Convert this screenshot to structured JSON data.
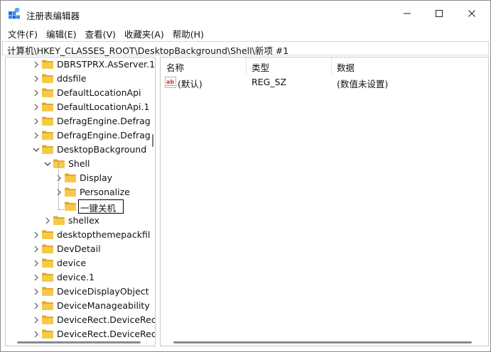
{
  "window": {
    "title": "注册表编辑器"
  },
  "menu": [
    "文件(F)",
    "编辑(E)",
    "查看(V)",
    "收藏夹(A)",
    "帮助(H)"
  ],
  "address": "计算机\\HKEY_CLASSES_ROOT\\DesktopBackground\\Shell\\新项 #1",
  "tree": [
    {
      "label": "DBRSTPRX.AsServer.1",
      "chevron": "right"
    },
    {
      "label": "ddsfile",
      "chevron": "right"
    },
    {
      "label": "DefaultLocationApi",
      "chevron": "right"
    },
    {
      "label": "DefaultLocationApi.1",
      "chevron": "right"
    },
    {
      "label": "DefragEngine.Defrag",
      "chevron": "right"
    },
    {
      "label": "DefragEngine.Defrag",
      "chevron": "right"
    },
    {
      "label": "DesktopBackground",
      "chevron": "down"
    },
    {
      "label": "Shell",
      "chevron": "down"
    },
    {
      "label": "Display",
      "chevron": "right"
    },
    {
      "label": "Personalize",
      "chevron": "right"
    },
    {
      "label": "一键关机",
      "chevron": "none",
      "editing": true
    },
    {
      "label": "shellex",
      "chevron": "right"
    },
    {
      "label": "desktopthemepackfil",
      "chevron": "right"
    },
    {
      "label": "DevDetail",
      "chevron": "right"
    },
    {
      "label": "device",
      "chevron": "right"
    },
    {
      "label": "device.1",
      "chevron": "right"
    },
    {
      "label": "DeviceDisplayObject",
      "chevron": "right"
    },
    {
      "label": "DeviceManageability",
      "chevron": "right"
    },
    {
      "label": "DeviceRect.DeviceRec",
      "chevron": "right"
    },
    {
      "label": "DeviceRect.DeviceRec",
      "chevron": "right"
    }
  ],
  "list": {
    "columns": [
      "名称",
      "类型",
      "数据"
    ],
    "rows": [
      {
        "name": "(默认)",
        "type": "REG_SZ",
        "data": "(数值未设置)",
        "icon": "string-value-icon"
      }
    ]
  },
  "colors": {
    "folder": "#f6c94a",
    "folder_dark": "#e2a925",
    "accent": "#1f6fd1"
  }
}
